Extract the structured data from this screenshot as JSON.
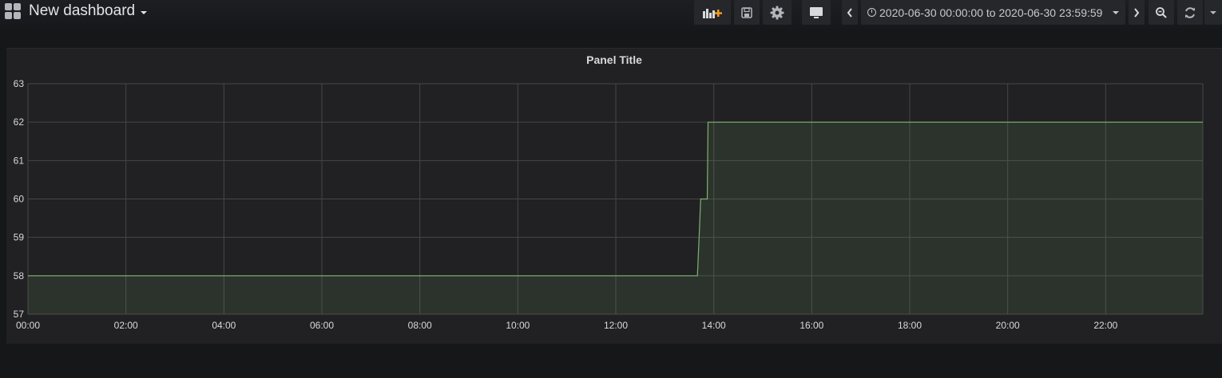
{
  "navbar": {
    "dashboard_title": "New dashboard",
    "time_range": "2020-06-30 00:00:00 to 2020-06-30 23:59:59",
    "icons": [
      "dashboard-grid-icon",
      "add-panel-icon",
      "save-icon",
      "settings-icon",
      "tv-mode-icon",
      "time-back-icon",
      "clock-icon",
      "time-forward-icon",
      "zoom-out-icon",
      "refresh-icon",
      "refresh-interval-caret-icon"
    ]
  },
  "panel": {
    "title": "Panel Title"
  },
  "colors": {
    "series": "#7eb26d",
    "background": "#161719",
    "panel": "#212124",
    "grid": "#464646"
  },
  "chart_data": {
    "type": "area",
    "title": "Panel Title",
    "xlabel": "",
    "ylabel": "",
    "grid": true,
    "legend": "none",
    "x_range": [
      "00:00",
      "23:59"
    ],
    "ylim": [
      57,
      63
    ],
    "y_ticks": [
      "57",
      "58",
      "59",
      "60",
      "61",
      "62",
      "63"
    ],
    "x_ticks": [
      "00:00",
      "02:00",
      "04:00",
      "06:00",
      "08:00",
      "10:00",
      "12:00",
      "14:00",
      "16:00",
      "18:00",
      "20:00",
      "22:00"
    ],
    "series": [
      {
        "x": [
          "00:00",
          "13:40",
          "13:42",
          "13:44",
          "13:46",
          "13:52",
          "13:53",
          "23:59"
        ],
        "values": [
          58,
          58,
          59,
          60,
          60,
          60,
          62,
          62
        ]
      }
    ]
  }
}
